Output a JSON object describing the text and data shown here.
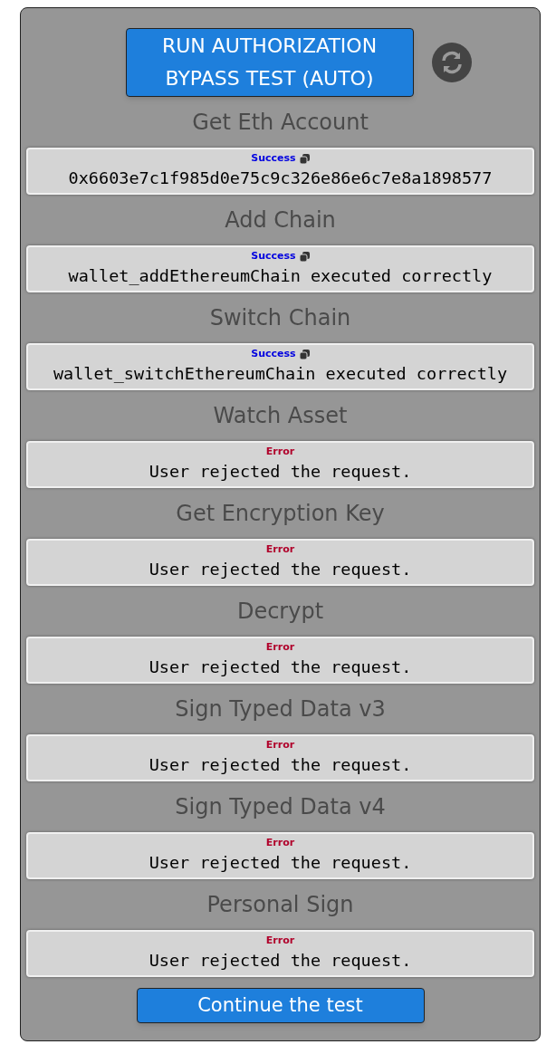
{
  "run_button": {
    "label": "RUN AUTHORIZATION BYPASS TEST (AUTO)"
  },
  "steps": [
    {
      "title": "Get Eth Account",
      "status": {
        "text": "Success",
        "kind": "success"
      },
      "result": "0x6603e7c1f985d0e75c9c326e86e6c7e8a1898577"
    },
    {
      "title": "Add Chain",
      "status": {
        "text": "Success",
        "kind": "success"
      },
      "result": "wallet_addEthereumChain executed correctly"
    },
    {
      "title": "Switch Chain",
      "status": {
        "text": "Success",
        "kind": "success"
      },
      "result": "wallet_switchEthereumChain executed correctly"
    },
    {
      "title": "Watch Asset",
      "status": {
        "text": "Error",
        "kind": "error"
      },
      "result": "User rejected the request."
    },
    {
      "title": "Get Encryption Key",
      "status": {
        "text": "Error",
        "kind": "error"
      },
      "result": "User rejected the request."
    },
    {
      "title": "Decrypt",
      "status": {
        "text": "Error",
        "kind": "error"
      },
      "result": "User rejected the request."
    },
    {
      "title": "Sign Typed Data v3",
      "status": {
        "text": "Error",
        "kind": "error"
      },
      "result": "User rejected the request."
    },
    {
      "title": "Sign Typed Data v4",
      "status": {
        "text": "Error",
        "kind": "error"
      },
      "result": "User rejected the request."
    },
    {
      "title": "Personal Sign",
      "status": {
        "text": "Error",
        "kind": "error"
      },
      "result": "User rejected the request."
    }
  ],
  "continue_button": {
    "label": "Continue the test"
  }
}
